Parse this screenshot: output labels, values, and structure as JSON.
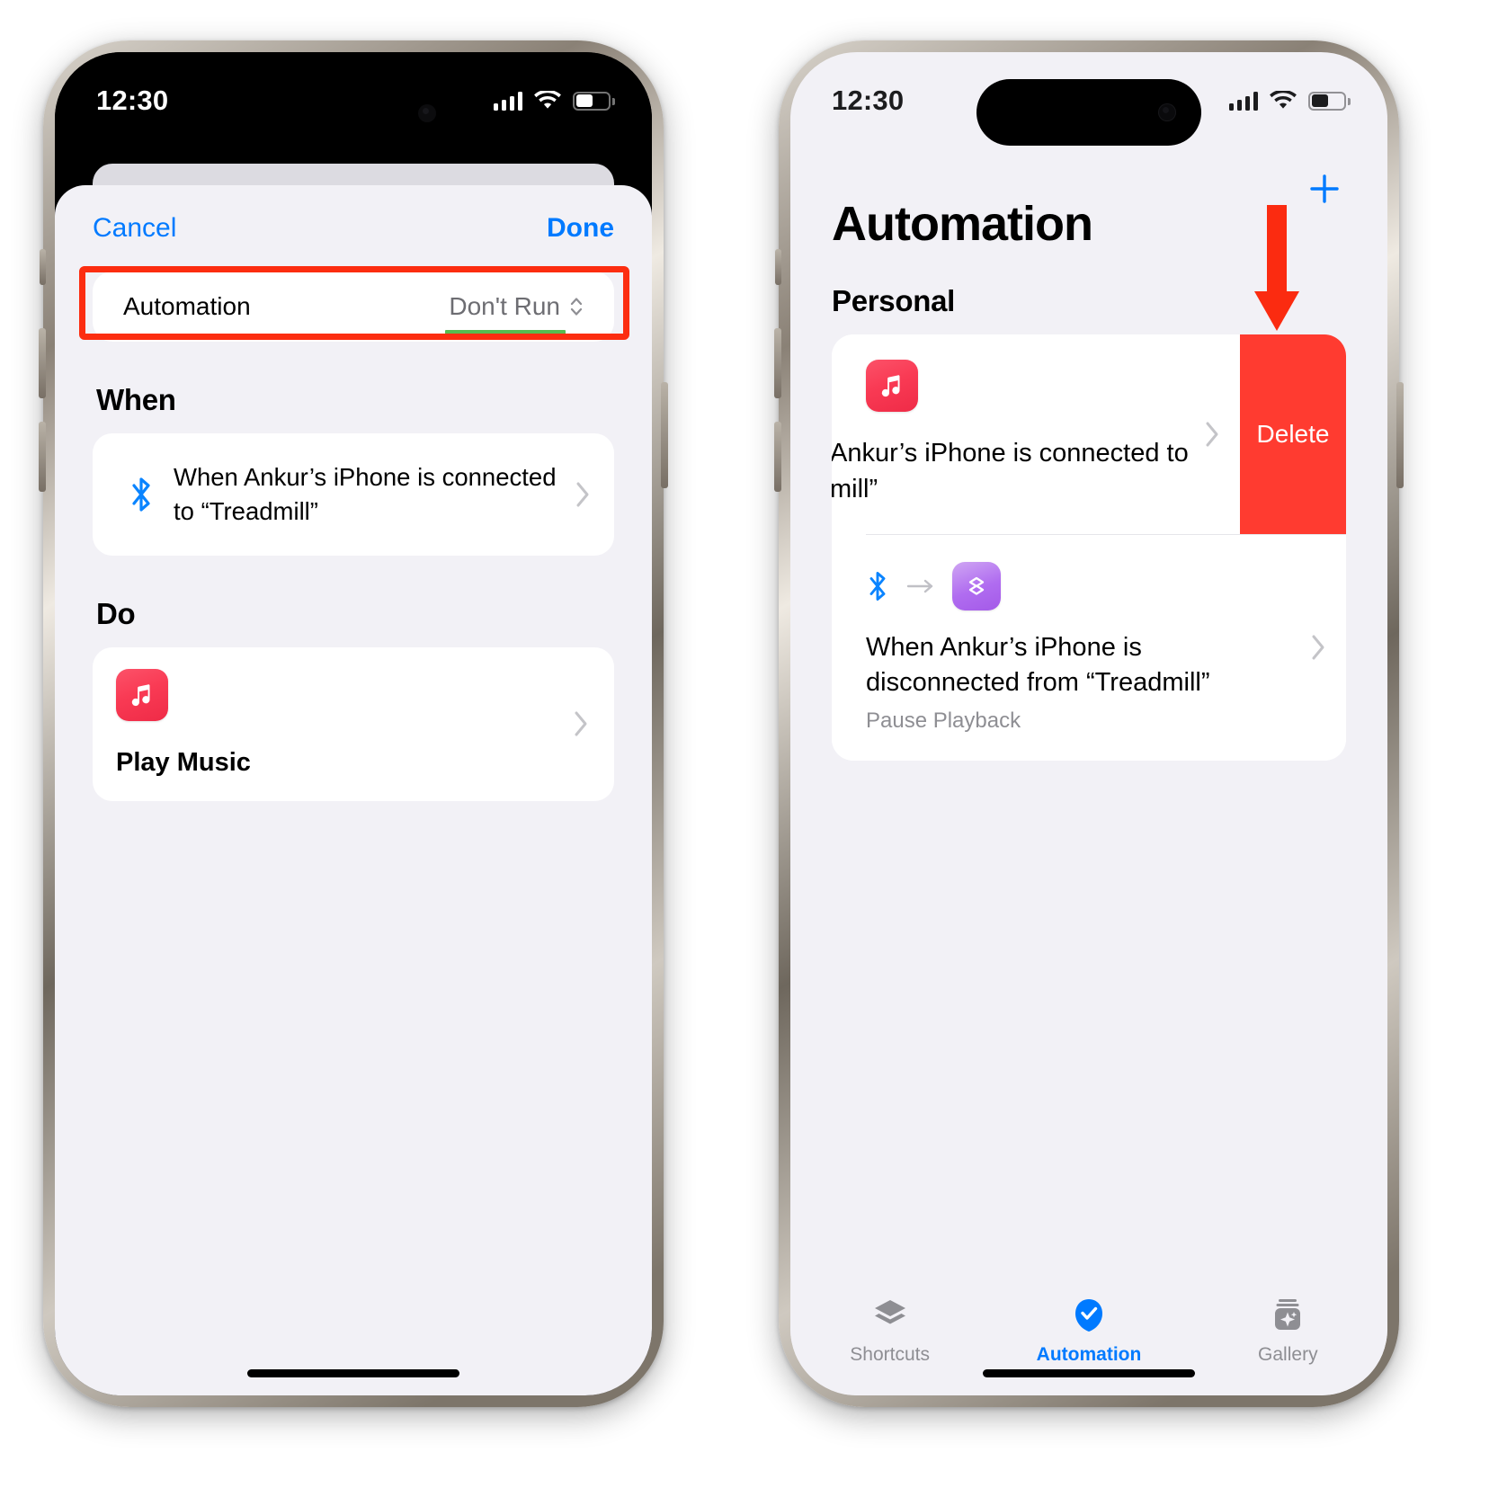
{
  "statusbar": {
    "time": "12:30",
    "signal_icon": "cellular-bars-icon",
    "wifi_icon": "wifi-icon",
    "battery_icon": "battery-icon"
  },
  "left_phone": {
    "nav": {
      "cancel_label": "Cancel",
      "done_label": "Done"
    },
    "automation_row": {
      "label": "Automation",
      "value": "Don't Run",
      "stepper_icon": "up-down-chevron-icon",
      "highlight_color": "#fc2d10",
      "underline_color": "#57bb50"
    },
    "when_section": {
      "title": "When",
      "item": {
        "icon": "bluetooth-icon",
        "text": "When Ankur’s iPhone is connected to “Treadmill”",
        "chevron": "chevron-right-icon"
      }
    },
    "do_section": {
      "title": "Do",
      "item": {
        "icon": "music-app-icon",
        "title": "Play Music",
        "chevron": "chevron-right-icon"
      }
    }
  },
  "right_phone": {
    "add_button_icon": "plus-icon",
    "page_title": "Automation",
    "group_title": "Personal",
    "rows": [
      {
        "icon": "music-app-icon",
        "title": "Ankur’s iPhone is connected to mill”",
        "chevron": "chevron-right-icon",
        "swipe_action_label": "Delete",
        "swipe_action_color": "#ff3b30"
      },
      {
        "trigger_icon": "bluetooth-icon",
        "arrow_icon": "arrow-right-icon",
        "action_icon": "shortcuts-app-icon",
        "title": "When Ankur’s iPhone is disconnected from “Treadmill”",
        "subtitle": "Pause Playback",
        "chevron": "chevron-right-icon"
      }
    ],
    "tabs": [
      {
        "label": "Shortcuts",
        "icon": "shortcuts-stack-icon",
        "active": false
      },
      {
        "label": "Automation",
        "icon": "automation-check-icon",
        "active": true
      },
      {
        "label": "Gallery",
        "icon": "gallery-sparkle-icon",
        "active": false
      }
    ],
    "annotation": {
      "arrow_icon": "down-arrow-annotation",
      "color": "#fb2b10"
    }
  },
  "colors": {
    "accent_blue": "#007aff",
    "annotation_red": "#fc2d10",
    "highlight_green": "#57bb50",
    "delete_red": "#ff3b30",
    "screen_bg": "#f2f1f6"
  }
}
